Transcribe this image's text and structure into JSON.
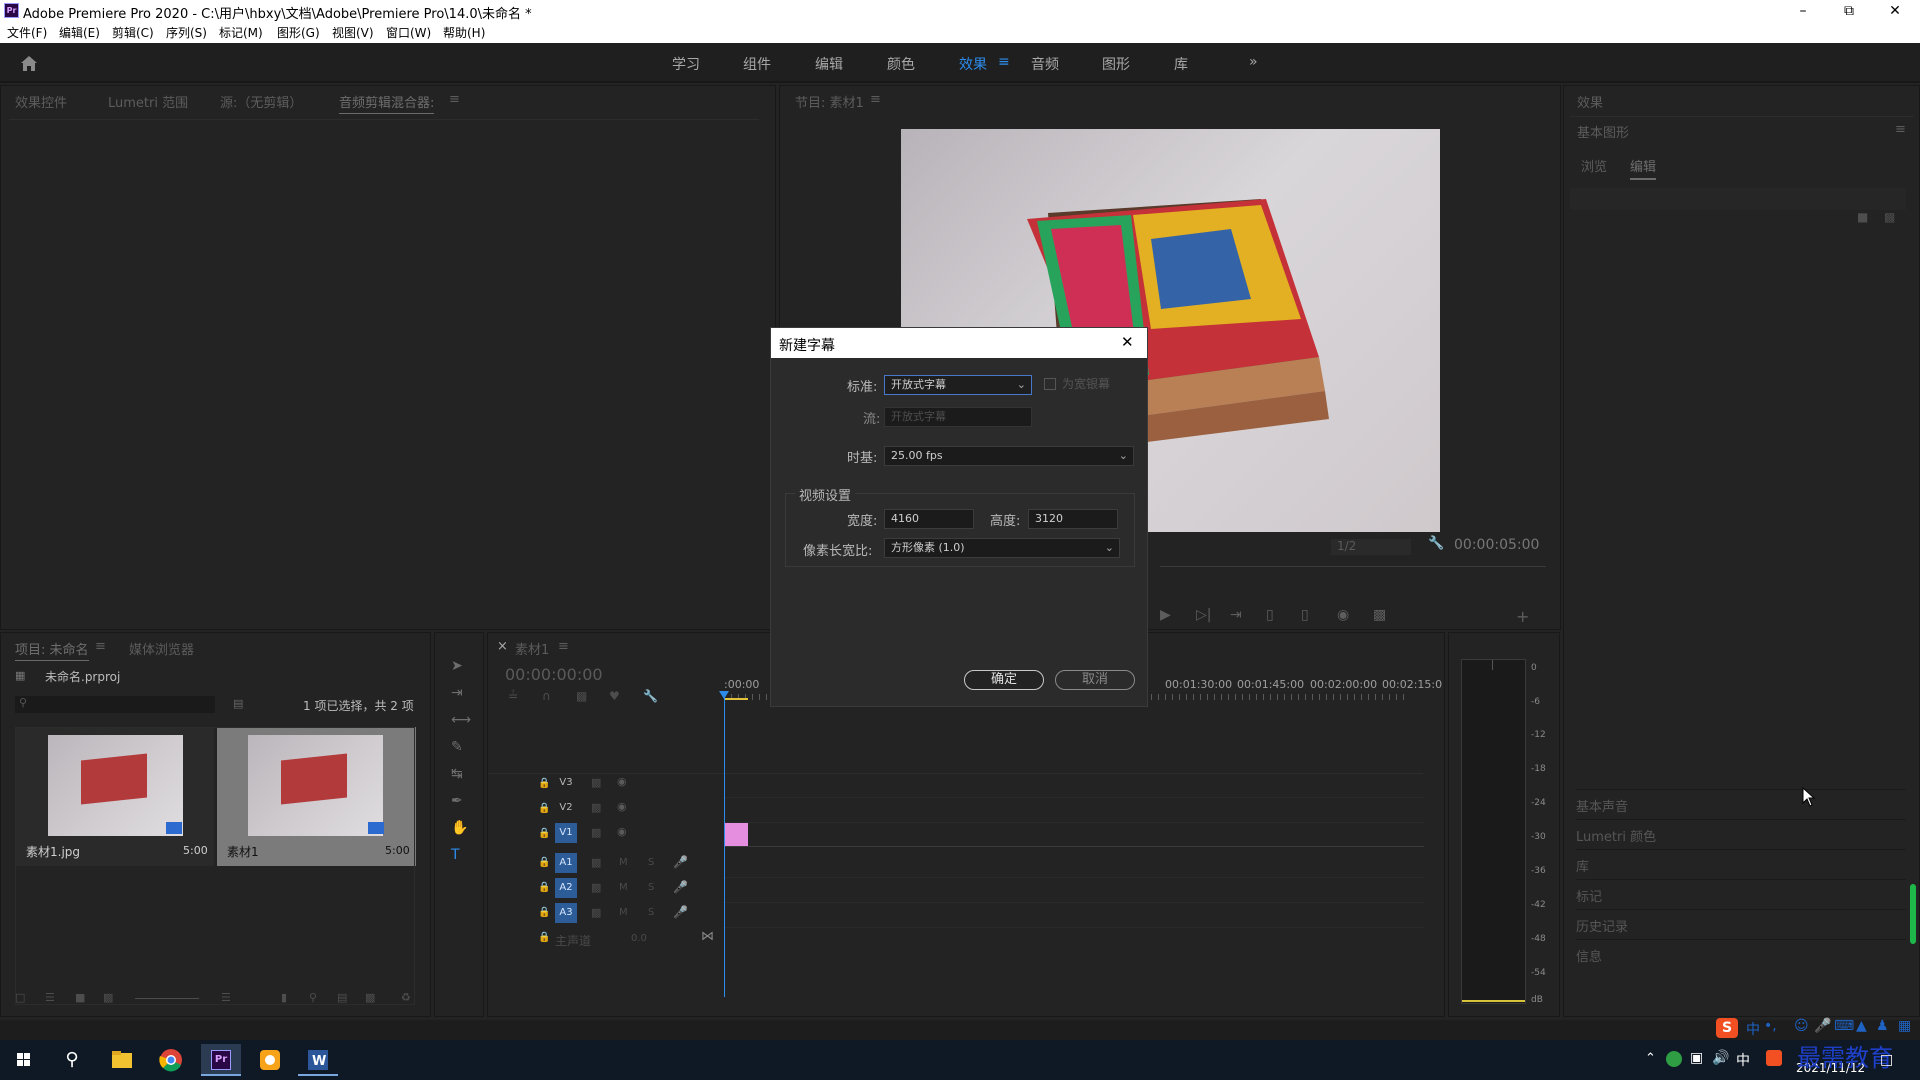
{
  "app": {
    "title": "Adobe Premiere Pro 2020 - C:\\用户\\hbxy\\文档\\Adobe\\Premiere Pro\\14.0\\未命名 *",
    "logo_text": "Pr"
  },
  "menu": [
    "文件(F)",
    "编辑(E)",
    "剪辑(C)",
    "序列(S)",
    "标记(M)",
    "图形(G)",
    "视图(V)",
    "窗口(W)",
    "帮助(H)"
  ],
  "workspaces": [
    "学习",
    "组件",
    "编辑",
    "颜色",
    "效果",
    "音频",
    "图形",
    "库"
  ],
  "workspaces_active": "效果",
  "source_panel": {
    "tabs": [
      "效果控件",
      "Lumetri 范围",
      "源:（无剪辑）",
      "音频剪辑混合器:"
    ]
  },
  "program_panel": {
    "tab": "节目: 素材1",
    "timecode": "00:00:05:00",
    "zoom": "1/2"
  },
  "effects_panel": {
    "title": "效果",
    "essential_graphics": "基本图形",
    "tabs": [
      "浏览",
      "编辑"
    ],
    "active_tab": "编辑",
    "collapsed": [
      "基本声音",
      "Lumetri 颜色",
      "库",
      "标记",
      "历史记录",
      "信息"
    ]
  },
  "project_panel": {
    "tabs": [
      "项目: 未命名",
      "媒体浏览器"
    ],
    "file": "未命名.prproj",
    "selection_info": "1 项已选择，共 2 项",
    "items": [
      {
        "name": "素材1.jpg",
        "duration": "5:00"
      },
      {
        "name": "素材1",
        "duration": "5:00"
      }
    ]
  },
  "timeline": {
    "tab": "素材1",
    "timecode": "00:00:00:00",
    "ruler": [
      ":00:00",
      "00:01:30:00",
      "00:01:45:00",
      "00:02:00:00",
      "00:02:15:0"
    ],
    "video_tracks": [
      "V3",
      "V2",
      "V1"
    ],
    "audio_tracks": [
      "A1",
      "A2",
      "A3"
    ],
    "master": "主声道",
    "master_value": "0.0",
    "track_buttons": {
      "mute": "M",
      "solo": "S"
    }
  },
  "meter": {
    "labels": [
      "0",
      "-6",
      "-12",
      "-18",
      "-24",
      "-30",
      "-36",
      "-42",
      "-48",
      "-54",
      "dB"
    ]
  },
  "dialog": {
    "title": "新建字幕",
    "standard_label": "标准:",
    "standard_value": "开放式字幕",
    "teletext_label": "为宽银幕",
    "stream_label": "流:",
    "stream_value": "开放式字幕",
    "timebase_label": "时基:",
    "timebase_value": "25.00 fps",
    "video_settings": "视频设置",
    "width_label": "宽度:",
    "width_value": "4160",
    "height_label": "高度:",
    "height_value": "3120",
    "par_label": "像素长宽比:",
    "par_value": "方形像素 (1.0)",
    "ok": "确定",
    "cancel": "取消"
  },
  "taskbar": {
    "date": "2021/11/12",
    "ime": "中",
    "watermark": "最需教育"
  },
  "colors": {
    "accent": "#2d8ceb",
    "clip": "#e58ee0",
    "playhead": "#2d8ceb",
    "ime_orange": "#f25022"
  }
}
